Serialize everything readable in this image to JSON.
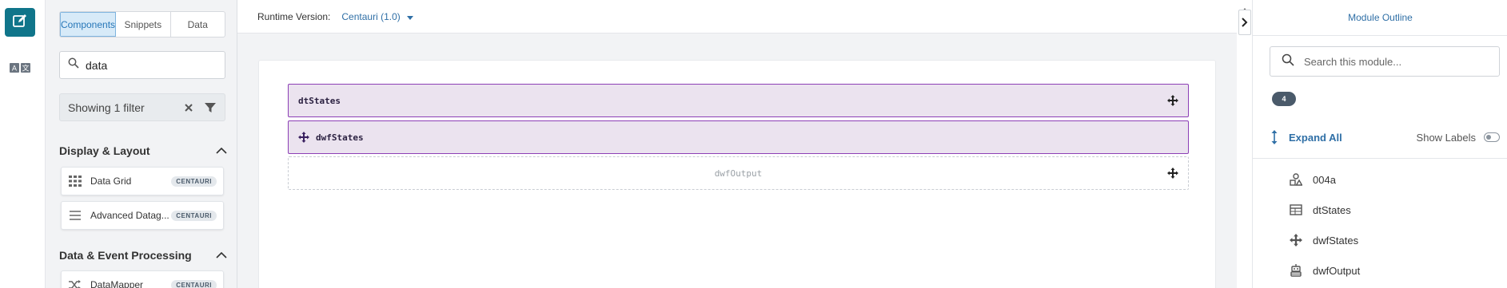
{
  "left_rail": {
    "items": [
      {
        "icon": "edit-icon",
        "active": true
      },
      {
        "icon": "ab-translate-icon",
        "active": false
      }
    ]
  },
  "components_panel": {
    "tabs": [
      {
        "label": "Components",
        "active": true
      },
      {
        "label": "Snippets",
        "active": false
      },
      {
        "label": "Data",
        "active": false
      }
    ],
    "search": {
      "value": "data"
    },
    "filter": {
      "text": "Showing 1 filter"
    },
    "sections": [
      {
        "title": "Display & Layout",
        "expanded": true,
        "items": [
          {
            "label": "Data Grid",
            "badge": "CENTAURI",
            "icon": "grid-icon"
          },
          {
            "label": "Advanced Datag...",
            "badge": "CENTAURI",
            "icon": "lines-icon"
          }
        ]
      },
      {
        "title": "Data & Event Processing",
        "expanded": true,
        "items": [
          {
            "label": "DataMapper",
            "badge": "CENTAURI",
            "icon": "shuffle-icon"
          }
        ]
      }
    ]
  },
  "toolbar": {
    "runtime_label": "Runtime Version:",
    "runtime_value": "Centauri (1.0)"
  },
  "canvas": {
    "components": [
      {
        "name": "dtStates",
        "style": "selected"
      },
      {
        "name": "dwfStates",
        "style": "selected"
      },
      {
        "name": "dwfOutput",
        "style": "placeholder"
      }
    ]
  },
  "outline": {
    "title": "Module Outline",
    "search_placeholder": "Search this module...",
    "count": "4",
    "expand_all": "Expand All",
    "show_labels": "Show Labels",
    "show_labels_on": false,
    "items": [
      {
        "label": "004a",
        "icon": "shapes-icon"
      },
      {
        "label": "dtStates",
        "icon": "table-icon"
      },
      {
        "label": "dwfStates",
        "icon": "move-icon"
      },
      {
        "label": "dwfOutput",
        "icon": "robot-icon"
      }
    ]
  },
  "colors": {
    "accent": "#10758a",
    "link": "#2f6fa6",
    "selection_border": "#8c3fb6",
    "selection_fill": "#ebe3ef"
  }
}
